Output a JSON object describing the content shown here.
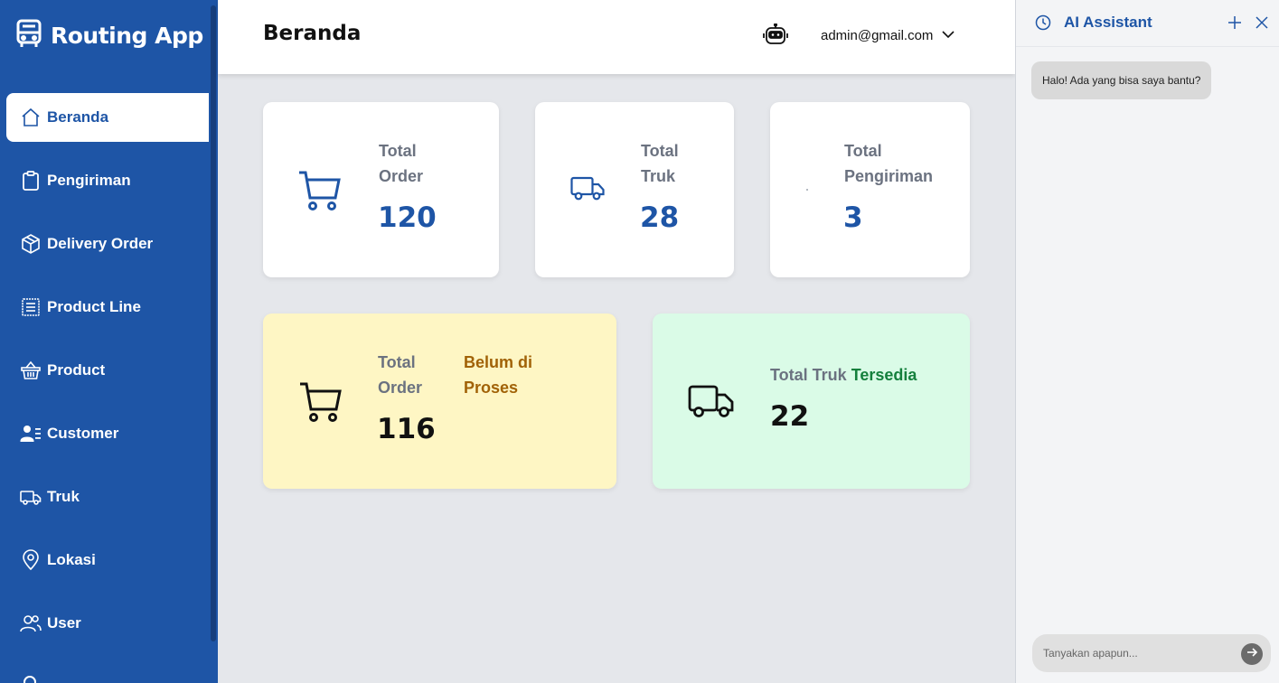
{
  "app": {
    "brand": "Routing App"
  },
  "sidebar": {
    "items": [
      {
        "label": "Beranda",
        "icon": "home-icon"
      },
      {
        "label": "Pengiriman",
        "icon": "clipboard-icon"
      },
      {
        "label": "Delivery Order",
        "icon": "box-icon"
      },
      {
        "label": "Product Line",
        "icon": "list-icon"
      },
      {
        "label": "Product",
        "icon": "basket-icon"
      },
      {
        "label": "Customer",
        "icon": "customer-icon"
      },
      {
        "label": "Truk",
        "icon": "truck-icon"
      },
      {
        "label": "Lokasi",
        "icon": "location-icon"
      },
      {
        "label": "User",
        "icon": "users-icon"
      }
    ]
  },
  "header": {
    "title": "Beranda",
    "user_email": "admin@gmail.com"
  },
  "cards": {
    "total_order": {
      "label_1": "Total",
      "label_2": "Order",
      "value": "120"
    },
    "total_truk": {
      "label_1": "Total",
      "label_2": "Truk",
      "value": "28"
    },
    "total_pengiriman": {
      "label_1": "Total",
      "label_2": "Pengiriman",
      "value": "3"
    },
    "order_unprocessed": {
      "label_1": "Total",
      "label_2": "Order",
      "status_1": "Belum di",
      "status_2": "Proses",
      "value": "116"
    },
    "truk_available": {
      "label": "Total Truk",
      "status": "Tersedia",
      "value": "22"
    }
  },
  "ai": {
    "title": "AI Assistant",
    "greeting": "Halo! Ada yang bisa saya bantu?",
    "input_placeholder": "Tanyakan apapun..."
  },
  "colors": {
    "primary": "#1e55a6",
    "yellow_card": "#fef6c4",
    "green_card": "#dafbe7",
    "amber_text": "#a16207",
    "green_text": "#15803d"
  }
}
